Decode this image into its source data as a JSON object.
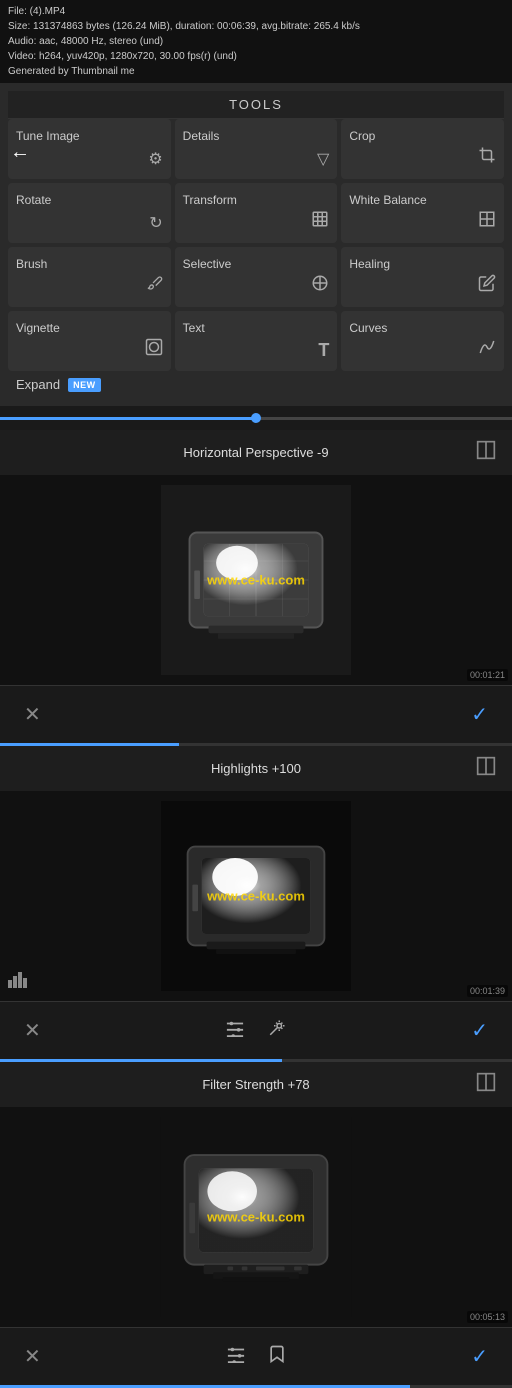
{
  "fileInfo": {
    "filename": "File: (4).MP4",
    "size": "Size: 131374863 bytes (126.24 MiB), duration: 00:06:39, avg.bitrate: 265.4 kb/s",
    "audio": "Audio: aac, 48000 Hz, stereo (und)",
    "video": "Video: h264, yuv420p, 1280x720, 30.00 fps(r) (und)",
    "generated": "Generated by Thumbnail me"
  },
  "toolsHeader": "TOOLS",
  "backButton": "←",
  "tools": [
    {
      "label": "Tune Image",
      "icon": "⚙"
    },
    {
      "label": "Details",
      "icon": "▽"
    },
    {
      "label": "Crop",
      "icon": "⊡"
    },
    {
      "label": "Rotate",
      "icon": "↻"
    },
    {
      "label": "Transform",
      "icon": "⊞"
    },
    {
      "label": "White Balance",
      "icon": "◪"
    },
    {
      "label": "Brush",
      "icon": "✏"
    },
    {
      "label": "Selective",
      "icon": "⊙"
    },
    {
      "label": "Healing",
      "icon": "✕"
    },
    {
      "label": "Vignette",
      "icon": "⊙"
    },
    {
      "label": "Text",
      "icon": "T"
    },
    {
      "label": "Curves",
      "icon": "⤴"
    }
  ],
  "expandLabel": "Expand",
  "newBadge": "NEW",
  "panels": [
    {
      "id": "horizontal-perspective",
      "title": "Horizontal Perspective -9",
      "timecode": "00:01:21",
      "hasGridOverlay": true
    },
    {
      "id": "highlights",
      "title": "Highlights +100",
      "timecode": "00:01:39",
      "hasHistogram": true
    },
    {
      "id": "filter-strength",
      "title": "Filter Strength +78",
      "timecode": "00:05:13"
    }
  ],
  "watermark": "www.ce-ku.com",
  "actionBar": {
    "cancelIcon": "✕",
    "confirmIcon": "✓",
    "sliderIcon": "⚙",
    "brushIcon": "✏"
  }
}
